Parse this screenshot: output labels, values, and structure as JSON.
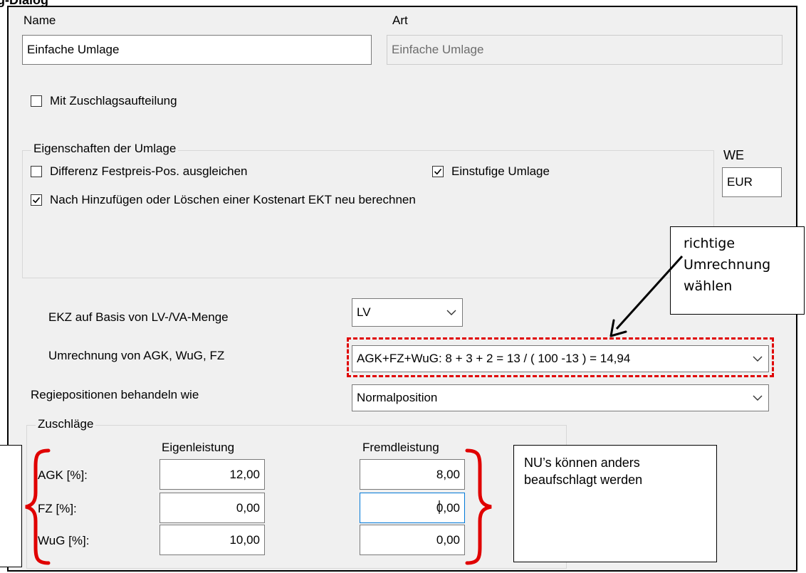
{
  "caption": "g-Dialog",
  "name": {
    "label": "Name",
    "value": "Einfache Umlage"
  },
  "art": {
    "label": "Art",
    "value": "Einfache Umlage"
  },
  "zuschlagsaufteilung": {
    "label": "Mit Zuschlagsaufteilung",
    "checked": false
  },
  "eigenschaften": {
    "title": "Eigenschaften der Umlage",
    "differenz": {
      "label": "Differenz Festpreis-Pos. ausgleichen",
      "checked": false
    },
    "einstufig": {
      "label": "Einstufige Umlage",
      "checked": true
    },
    "ekt": {
      "label": "Nach Hinzufügen oder Löschen einer Kostenart EKT neu berechnen",
      "checked": true
    }
  },
  "we": {
    "label": "WE",
    "value": "EUR"
  },
  "ekz": {
    "label": "EKZ auf Basis von LV-/VA-Menge",
    "value": "LV"
  },
  "umrechnung": {
    "label": "Umrechnung von AGK, WuG, FZ",
    "value": "AGK+FZ+WuG: 8 + 3 + 2 = 13 / ( 100 -13 ) = 14,94"
  },
  "regie": {
    "label": "Regiepositionen behandeln wie",
    "value": "Normalposition"
  },
  "zuschlaege": {
    "title": "Zuschläge",
    "col_eigen": "Eigenleistung",
    "col_fremd": "Fremdleistung",
    "rows": [
      {
        "label": "AGK [%]:",
        "eigen": "12,00",
        "fremd": "8,00"
      },
      {
        "label": "FZ [%]:",
        "eigen": "0,00",
        "fremd": "0,00"
      },
      {
        "label": "WuG [%]:",
        "eigen": "10,00",
        "fremd": "0,00"
      }
    ]
  },
  "callout_umrechnung": {
    "line1": "richtige",
    "line2": "Umrechnung",
    "line3": "wählen"
  },
  "callout_nu": {
    "line1": "NU’s können anders",
    "line2": "beaufschlagt werden"
  },
  "colors": {
    "dialog_bg": "#f0f0f0",
    "highlight": "#e00000",
    "brace": "#e00000",
    "focus": "#0078d7"
  },
  "icons": [
    "checkmark-icon",
    "chevron-down-icon",
    "arrow-icon",
    "curly-brace-icon"
  ]
}
